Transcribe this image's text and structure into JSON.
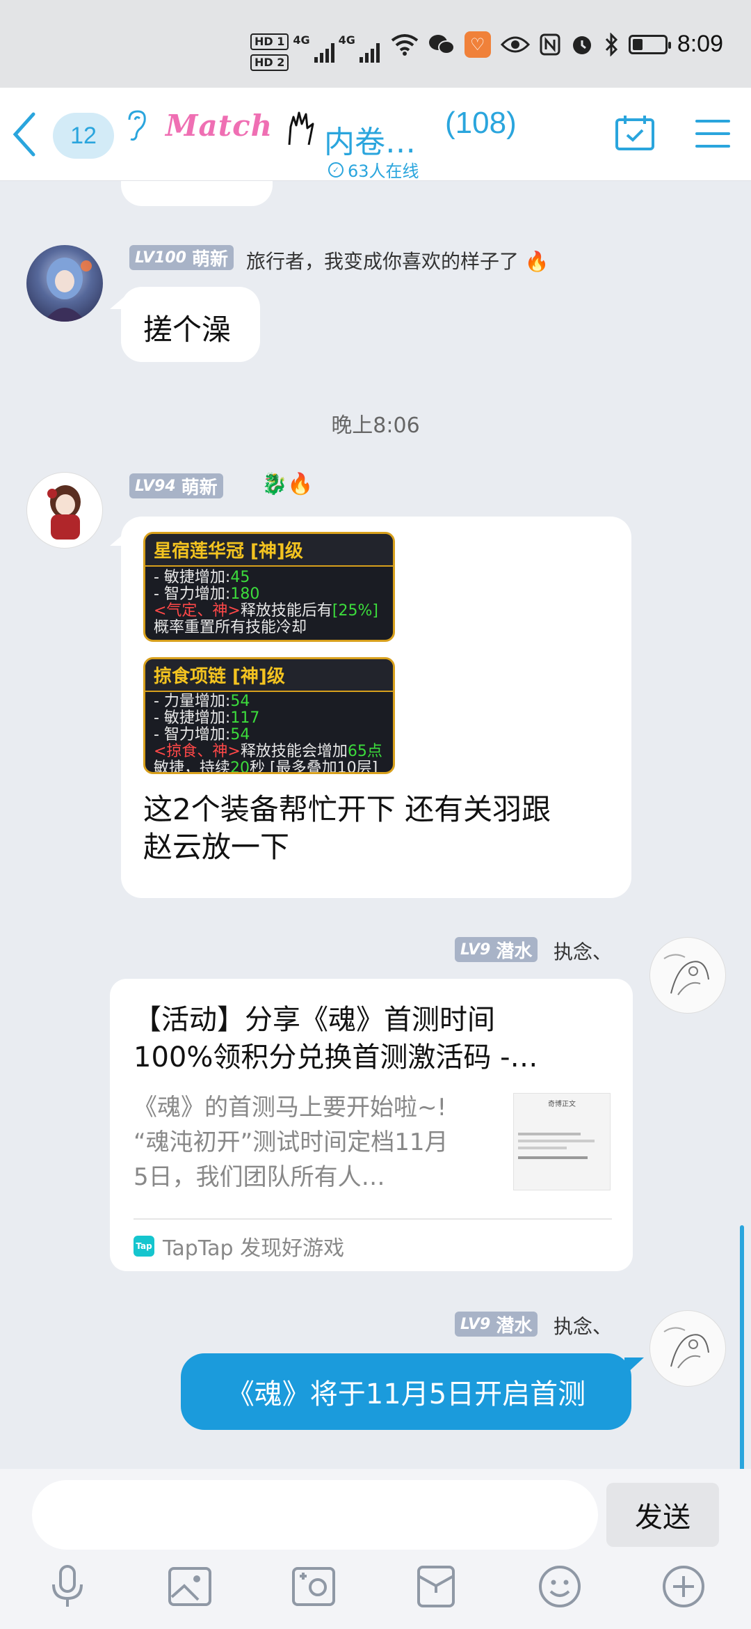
{
  "status_bar": {
    "hd1": "HD 1",
    "hd2": "HD 2",
    "net1": "4G",
    "net2": "4G",
    "time": "8:09"
  },
  "header": {
    "unread_count": "12",
    "logo_text": "Match",
    "group_name": "内卷…",
    "member_count": "(108)",
    "online_text": "63人在线"
  },
  "messages": [
    {
      "level": "LV100",
      "rank": "萌新",
      "sender": "旅行者，我变成你喜欢的样子了",
      "text": "搓个澡"
    },
    {
      "timestamp": "晚上8:06"
    },
    {
      "level": "LV94",
      "rank": "萌新",
      "equip1": {
        "title": "星宿莲华冠 [神]级",
        "line1": "- 敏捷增加:",
        "val1": "45",
        "line2": "- 智力增加:",
        "val2": "180",
        "line3_red": "<气定、神>",
        "line3": "释放技能后有",
        "line3_val": "[25%]",
        "line4": "概率重置所有技能冷却"
      },
      "equip2": {
        "title": "掠食项链 [神]级",
        "line1": "- 力量增加:",
        "val1": "54",
        "line2": "- 敏捷增加:",
        "val2": "117",
        "line3": "- 智力增加:",
        "val3": "54",
        "line4_red": "<掠食、神>",
        "line4": "释放技能会增加",
        "line4_val": "65点",
        "line5": "敏捷，持续",
        "line5_val": "20",
        "line5_end": "秒 [最多叠加10层]"
      },
      "text_line1": "这2个装备帮忙开下 还有关羽跟",
      "text_line2": "赵云放一下"
    },
    {
      "level": "LV9",
      "rank": "潜水",
      "sender": "执念、",
      "card": {
        "title_line1": "【活动】分享《魂》首测时间",
        "title_line2": "100%领积分兑换首测激活码 -…",
        "desc_line1": "《魂》的首测马上要开始啦~!",
        "desc_line2": "“魂沌初开”测试时间定档11月",
        "desc_line3": "5日，我们团队所有人…",
        "thumb_title": "奇博正文",
        "source": "TapTap 发现好游戏",
        "source_icon": "Tap"
      }
    },
    {
      "level": "LV9",
      "rank": "潜水",
      "sender": "执念、",
      "text": "《魂》将于11月5日开启首测"
    }
  ],
  "input": {
    "placeholder": "",
    "send_label": "发送"
  },
  "colors": {
    "accent": "#2aa5dd",
    "my_bubble": "#1b9bdc",
    "badge": "#a8b3c7",
    "background": "#e9ecf1"
  }
}
